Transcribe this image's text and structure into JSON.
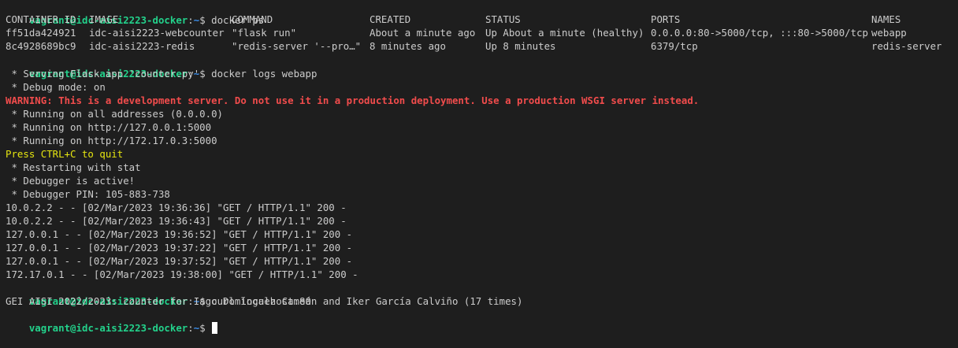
{
  "prompt": {
    "user_host": "vagrant@idc-aisi2223-docker",
    "sep": ":",
    "path": "~",
    "symbol": "$"
  },
  "commands": {
    "ps": " docker ps",
    "logs": " docker logs webapp",
    "curl": " curl localhost:80"
  },
  "ps_table": {
    "headers": [
      "CONTAINER ID",
      "IMAGE",
      "COMMAND",
      "CREATED",
      "STATUS",
      "PORTS",
      "NAMES"
    ],
    "rows": [
      [
        "ff51da424921",
        "idc-aisi2223-webcounter",
        "\"flask run\"",
        "About a minute ago",
        "Up About a minute (healthy)",
        "0.0.0.0:80->5000/tcp, :::80->5000/tcp",
        "webapp"
      ],
      [
        "8c4928689bc9",
        "idc-aisi2223-redis",
        "\"redis-server '--pro…\"",
        "8 minutes ago",
        "Up 8 minutes",
        "6379/tcp",
        "redis-server"
      ]
    ]
  },
  "logs": {
    "serving": " * Serving Flask app 'counter.py'",
    "debug_mode": " * Debug mode: on",
    "warning": "WARNING: This is a development server. Do not use it in a production deployment. Use a production WSGI server instead.",
    "running_all": " * Running on all addresses (0.0.0.0)",
    "running_local": " * Running on http://127.0.0.1:5000",
    "running_ip": " * Running on http://172.17.0.3:5000",
    "quit": "Press CTRL+C to quit",
    "restarting": " * Restarting with stat",
    "debugger_active": " * Debugger is active!",
    "debugger_pin": " * Debugger PIN: 105-883-738",
    "requests": [
      "10.0.2.2 - - [02/Mar/2023 19:36:36] \"GET / HTTP/1.1\" 200 -",
      "10.0.2.2 - - [02/Mar/2023 19:36:43] \"GET / HTTP/1.1\" 200 -",
      "127.0.0.1 - - [02/Mar/2023 19:36:52] \"GET / HTTP/1.1\" 200 -",
      "127.0.0.1 - - [02/Mar/2023 19:37:22] \"GET / HTTP/1.1\" 200 -",
      "127.0.0.1 - - [02/Mar/2023 19:37:52] \"GET / HTTP/1.1\" 200 -",
      "172.17.0.1 - - [02/Mar/2023 19:38:00] \"GET / HTTP/1.1\" 200 -"
    ]
  },
  "curl_output": "GEI AISI 2022/2023: counter for Iago Domínguez Cameán and Iker García Calviño (17 times)",
  "colors": {
    "background": "#1e1e1e",
    "foreground": "#cccccc",
    "prompt_green": "#23d18b",
    "path_blue": "#3b8eea",
    "warning_red": "#f14c4c",
    "yellow": "#e5e510"
  }
}
